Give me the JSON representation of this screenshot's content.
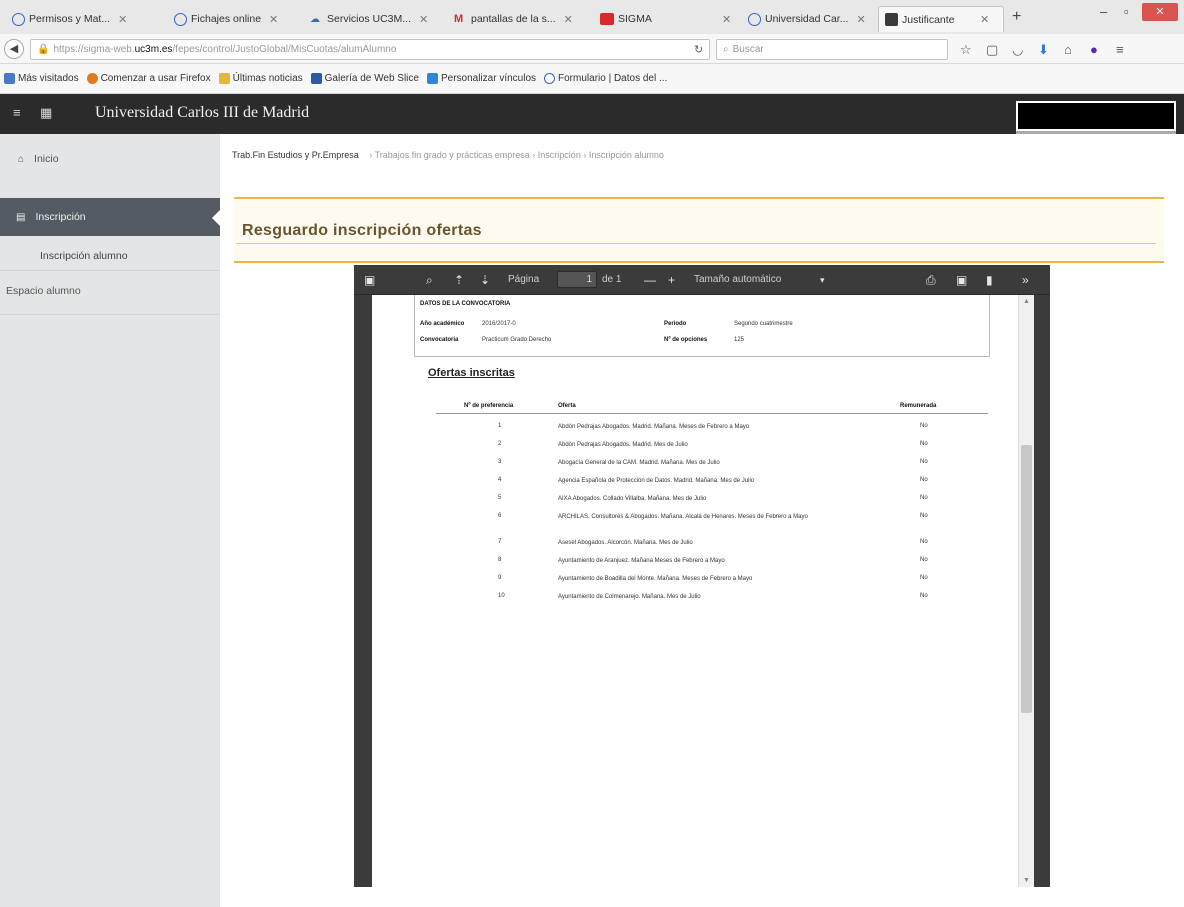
{
  "browser": {
    "tabs": [
      {
        "title": "Permisos y Mat...",
        "icon": "globe-icon"
      },
      {
        "title": "Fichajes online",
        "icon": "globe-icon"
      },
      {
        "title": "Servicios UC3M...",
        "icon": "cloud-icon"
      },
      {
        "title": "pantallas de la s...",
        "icon": "gmail-icon"
      },
      {
        "title": "SIGMA",
        "icon": "sigma-icon"
      },
      {
        "title": "Universidad Car...",
        "icon": "globe-icon"
      },
      {
        "title": "Justificante",
        "icon": "document-icon"
      }
    ],
    "close_glyph": "✕",
    "new_tab_glyph": "+",
    "url_prefix": "https://sigma-web.",
    "url_domain": "uc3m.es",
    "url_suffix": "/fepes/control/JustoGlobal/MisCuotas/alumAlumno",
    "search_placeholder": "Buscar",
    "bookmarks": [
      {
        "label": "Más visitados",
        "color": "#4a79c8"
      },
      {
        "label": "Comenzar a usar Firefox",
        "color": "#e07a1f"
      },
      {
        "label": "Últimas noticias",
        "color": "#e4b63a"
      },
      {
        "label": "Galería de Web Slice",
        "color": "#2a5aa8"
      },
      {
        "label": "Personalizar vínculos",
        "color": "#2b88d8"
      },
      {
        "label": "Formulario | Datos del ...",
        "color": "#3561c8"
      }
    ]
  },
  "app": {
    "name": "Universidad Carlos III de Madrid"
  },
  "sidebar": {
    "items": [
      {
        "label": "Inicio"
      },
      {
        "label": "Inscripción"
      },
      {
        "label": "Inscripción alumno"
      },
      {
        "label": "Espacio alumno"
      }
    ]
  },
  "main": {
    "breadcrumb_first": "Trab.Fin Estudios y Pr.Empresa",
    "breadcrumb_rest": "›  Trabajos fin grado y prácticas empresa  ›  Inscripción  ›  Inscripción alumno",
    "title": "Resguardo inscripción ofertas"
  },
  "pdf": {
    "page_label": "Página",
    "page_value": "1",
    "page_of": "de 1",
    "zoom": "Tamaño automático",
    "conv_heading": "DATOS DE LA CONVOCATORIA",
    "year_label": "Año académico",
    "year_value": "2016/2017-0",
    "period_label": "Periodo",
    "period_value": "Segundo cuatrimestre",
    "conv_label": "Convocatoria",
    "conv_value": "Practicum Grado Derecho",
    "opciones_label": "Nº de opciones",
    "opciones_value": "125",
    "ofertas_title": "Ofertas inscritas",
    "col_pref": "Nº de preferencia",
    "col_oferta": "Oferta",
    "col_rem": "Remunerada",
    "rows": [
      {
        "n": "1",
        "oferta": "Abdón Pedrajas Abogados. Madrid. Mañana. Meses de Febrero a Mayo",
        "rem": "No"
      },
      {
        "n": "2",
        "oferta": "Abdón Pedrajas Abogados. Madrid. Mes de Julio",
        "rem": "No"
      },
      {
        "n": "3",
        "oferta": "Abogacía General de la CAM. Madrid. Mañana. Mes de Julio",
        "rem": "No"
      },
      {
        "n": "4",
        "oferta": "Agencia Española de Protección de Datos. Madrid. Mañana. Mes de Julio",
        "rem": "No"
      },
      {
        "n": "5",
        "oferta": "AIXA Abogados. Collado Villalba. Mañana. Mes de Julio",
        "rem": "No"
      },
      {
        "n": "6",
        "oferta": "ARCHILAS. Consultores & Abogados. Mañana. Alcalá de Henares. Meses de Febrero a Mayo",
        "rem": "No"
      },
      {
        "n": "7",
        "oferta": "Asesel Abogados. Alcorcón. Mañana. Mes de Julio",
        "rem": "No"
      },
      {
        "n": "8",
        "oferta": "Ayuntamiento de Aranjuez. Mañana Meses de Febrero a Mayo",
        "rem": "No"
      },
      {
        "n": "9",
        "oferta": "Ayuntamiento de Boadilla del Monte. Mañana. Meses de Febrero a Mayo",
        "rem": "No"
      },
      {
        "n": "10",
        "oferta": "Ayuntamiento de Colmenarejo. Mañana. Mes de Julio",
        "rem": "No"
      }
    ]
  }
}
